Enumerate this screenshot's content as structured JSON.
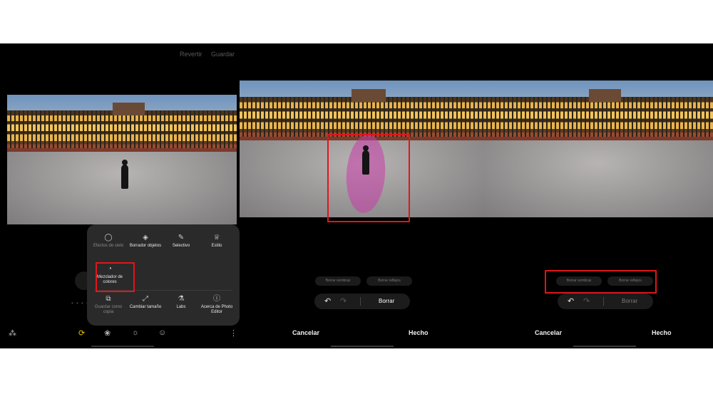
{
  "panel1": {
    "top_actions": [
      "Revertir",
      "Guardar"
    ],
    "menu_items": [
      {
        "icon": "effects-icon",
        "glyph": "◯",
        "label": "Efectos de cielo",
        "dim": true
      },
      {
        "icon": "eraser-icon",
        "glyph": "◈",
        "label": "Borrador objetos",
        "dim": false
      },
      {
        "icon": "selective-icon",
        "glyph": "✎",
        "label": "Selectivo",
        "dim": false
      },
      {
        "icon": "style-icon",
        "glyph": "♕",
        "label": "Estilo",
        "dim": false
      },
      {
        "icon": "palette-icon",
        "glyph": "◔",
        "label": "Mezclador de colores",
        "dim": false
      },
      {
        "icon": "save-copy-icon",
        "glyph": "⧉",
        "label": "Guardar como copia",
        "dim": true
      },
      {
        "icon": "resize-icon",
        "glyph": "⤢",
        "label": "Cambiar tamaño",
        "dim": false
      },
      {
        "icon": "labs-icon",
        "glyph": "⚗",
        "label": "Labs",
        "dim": false
      },
      {
        "icon": "info-icon",
        "glyph": "ⓘ",
        "label": "Acerca de Photo Editor",
        "dim": false
      }
    ],
    "toolbar": [
      "auto-enhance-icon",
      "transform-icon",
      "filters-icon",
      "tone-icon",
      "sticker-icon",
      "more-icon"
    ]
  },
  "panel2": {
    "pills": [
      "Borrar sombras",
      "Borrar reflejos"
    ],
    "undo_icon": "undo-icon",
    "redo_icon": "redo-icon",
    "erase_label": "Borrar",
    "cancel": "Cancelar",
    "done": "Hecho"
  },
  "panel3": {
    "pills": [
      "Borrar sombras",
      "Borrar reflejos"
    ],
    "erase_label": "Borrar",
    "cancel": "Cancelar",
    "done": "Hecho"
  }
}
